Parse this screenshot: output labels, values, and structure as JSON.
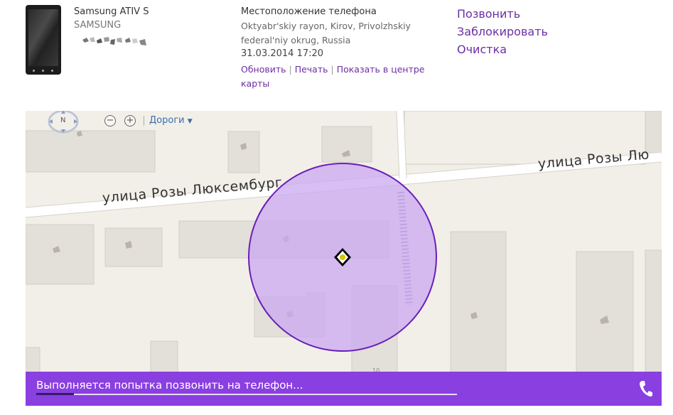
{
  "device": {
    "name": "Samsung ATIV S",
    "brand": "SAMSUNG"
  },
  "location": {
    "title": "Местоположение телефона",
    "address_line1": "Oktyabr'skiy rayon, Kirov, Privolzhskiy",
    "address_line2": "federal'niy okrug, Russia",
    "timestamp": "31.03.2014 17:20",
    "refresh_label": "Обновить",
    "print_label": "Печать",
    "center_label_line1": "Показать в центре",
    "center_label_line2": "карты",
    "separator": "|"
  },
  "actions": {
    "call_label": "Позвонить",
    "lock_label": "Заблокировать",
    "erase_label": "Очистка"
  },
  "map": {
    "compass_label": "N",
    "zoom_out": "−",
    "zoom_in": "+",
    "layer_label": "Дороги",
    "street_upper": "улица Розы Лю",
    "street_lower": "улица Розы Люксембург",
    "house_number": "10"
  },
  "status": {
    "message": "Выполняется попытка позвонить на телефон...",
    "progress": 0.09
  },
  "colors": {
    "accent": "#6b2fa4",
    "status_bar": "#8a3fe0",
    "accuracy_fill": "#c9a8f0",
    "accuracy_stroke": "#6a1fb8"
  },
  "icons": {
    "phone": "phone-icon",
    "compass": "compass-icon",
    "location_pin": "location-marker-icon"
  }
}
